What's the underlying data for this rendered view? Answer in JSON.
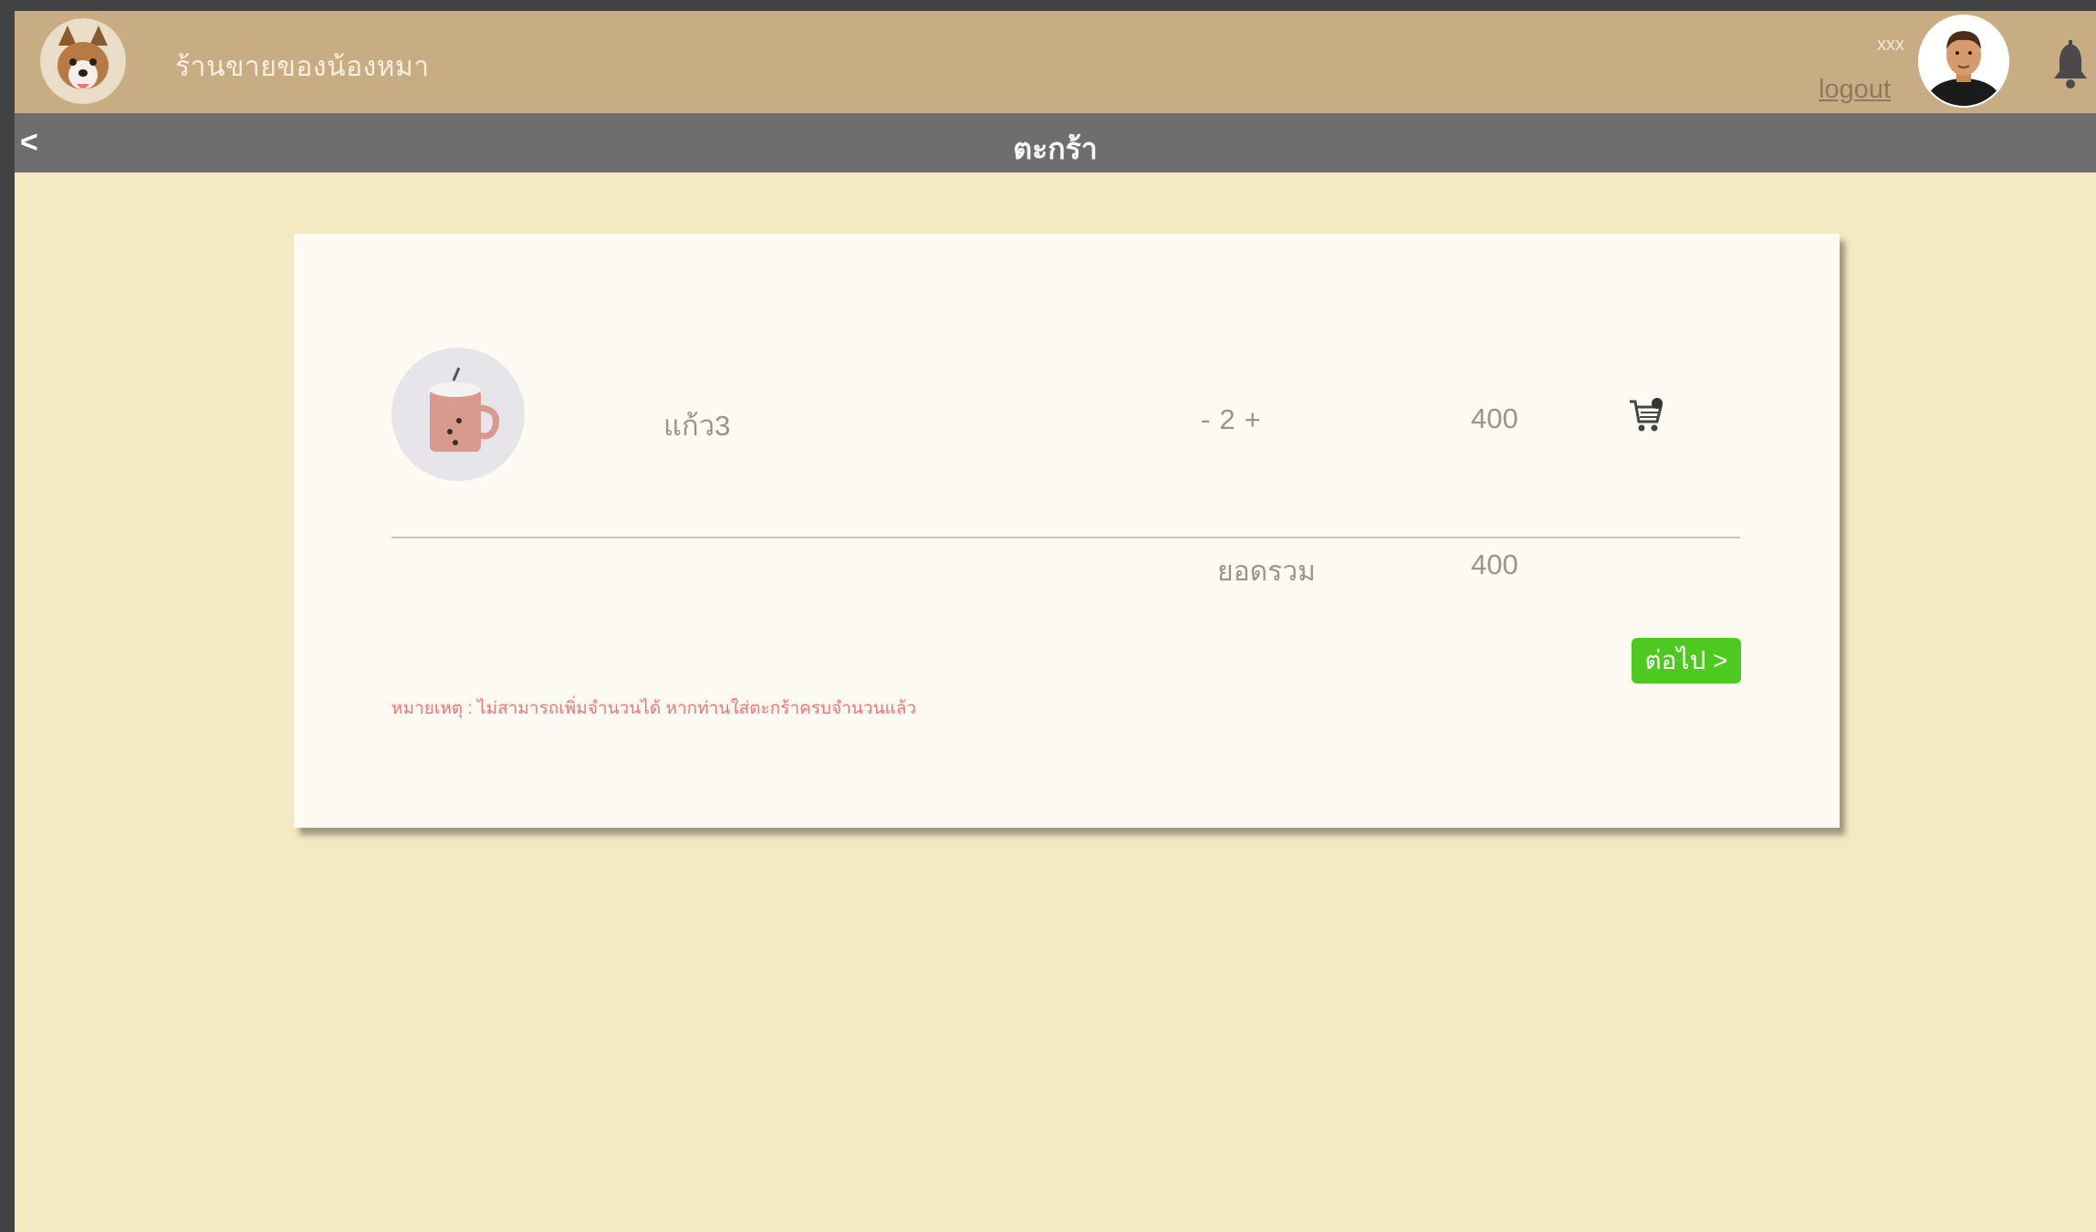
{
  "header": {
    "shop_name": "ร้านขายของน้องหมา",
    "username": "xxx",
    "logout_label": "logout"
  },
  "subbar": {
    "back_label": "<",
    "title": "ตะกร้า"
  },
  "cart": {
    "items": [
      {
        "name": "แก้ว3",
        "qty_minus": "-",
        "qty": "2",
        "qty_plus": "+",
        "price": "400",
        "image_icon": "pink-mug-image"
      }
    ],
    "total_label": "ยอดรวม",
    "total_value": "400",
    "next_label": "ต่อไป >",
    "note": "หมายเหตุ : ไม่สามารถเพิ่มจำนวนได้ หากท่านใส่ตะกร้าครบจำนวนแล้ว"
  },
  "colors": {
    "header_bg": "#c8ad84",
    "subbar_bg": "#6e6e6e",
    "page_bg": "#f3e8c2",
    "card_bg": "#fdfaf2",
    "next_button": "#4ec920",
    "note_text": "#f07474"
  }
}
